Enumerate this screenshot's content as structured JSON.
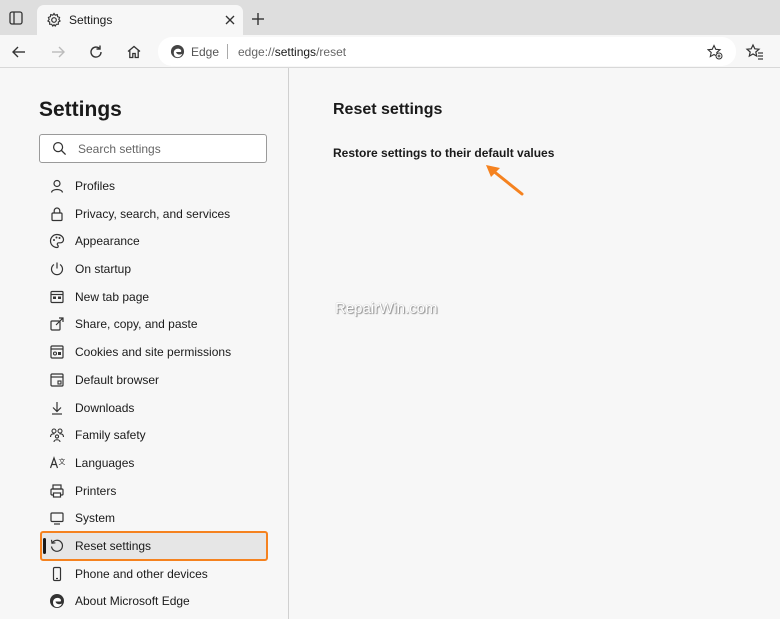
{
  "browser": {
    "tab_title": "Settings",
    "site_label": "Edge",
    "url_prefix": "edge://",
    "url_host": "settings",
    "url_path": "/reset"
  },
  "sidebar": {
    "title": "Settings",
    "search_placeholder": "Search settings",
    "items": [
      {
        "label": "Profiles",
        "icon": "profile-icon"
      },
      {
        "label": "Privacy, search, and services",
        "icon": "lock-icon"
      },
      {
        "label": "Appearance",
        "icon": "palette-icon"
      },
      {
        "label": "On startup",
        "icon": "power-icon"
      },
      {
        "label": "New tab page",
        "icon": "new-tab-icon"
      },
      {
        "label": "Share, copy, and paste",
        "icon": "share-icon"
      },
      {
        "label": "Cookies and site permissions",
        "icon": "cookies-icon"
      },
      {
        "label": "Default browser",
        "icon": "browser-icon"
      },
      {
        "label": "Downloads",
        "icon": "download-icon"
      },
      {
        "label": "Family safety",
        "icon": "family-icon"
      },
      {
        "label": "Languages",
        "icon": "language-icon"
      },
      {
        "label": "Printers",
        "icon": "printer-icon"
      },
      {
        "label": "System",
        "icon": "system-icon"
      },
      {
        "label": "Reset settings",
        "icon": "reset-icon",
        "active": true
      },
      {
        "label": "Phone and other devices",
        "icon": "phone-icon"
      },
      {
        "label": "About Microsoft Edge",
        "icon": "edge-icon"
      }
    ]
  },
  "main": {
    "title": "Reset settings",
    "restore_label": "Restore settings to their default values",
    "watermark": "RepairWin.com"
  },
  "colors": {
    "highlight": "#f5821f",
    "active_bg": "#e6e6e6"
  }
}
